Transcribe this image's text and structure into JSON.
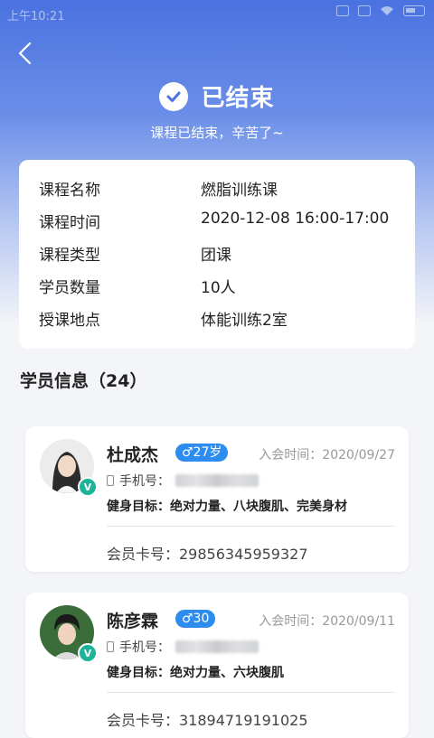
{
  "status_bar": {
    "time": "上午10:21"
  },
  "header": {
    "status_title": "已结束",
    "status_subtitle": "课程已结束，辛苦了~"
  },
  "course": {
    "rows": [
      {
        "label": "课程名称",
        "value": "燃脂训练课"
      },
      {
        "label": "课程时间",
        "value": "2020-12-08 16:00-17:00"
      },
      {
        "label": "课程类型",
        "value": "团课"
      },
      {
        "label": "学员数量",
        "value": "10人"
      },
      {
        "label": "授课地点",
        "value": "体能训练2室"
      }
    ]
  },
  "members_section": {
    "title": "学员信息（24）"
  },
  "members": [
    {
      "name": "杜成杰",
      "gender_age": "♂27岁",
      "join_time": "入会时间：2020/09/27",
      "phone_label": "手机号：",
      "goal": "健身目标：绝对力量、八块腹肌、完美身材",
      "card_no": "会员卡号：29856345959327",
      "verified_badge": "V"
    },
    {
      "name": "陈彦霖",
      "gender_age": "♂30",
      "join_time": "入会时间：2020/09/11",
      "phone_label": "手机号：",
      "goal": "健身目标：绝对力量、六块腹肌",
      "card_no": "会员卡号：31894719191025",
      "verified_badge": "V"
    }
  ],
  "colors": {
    "accent": "#4a72e0",
    "badge_blue": "#2d8cf0",
    "verified_green": "#1bb39a"
  }
}
